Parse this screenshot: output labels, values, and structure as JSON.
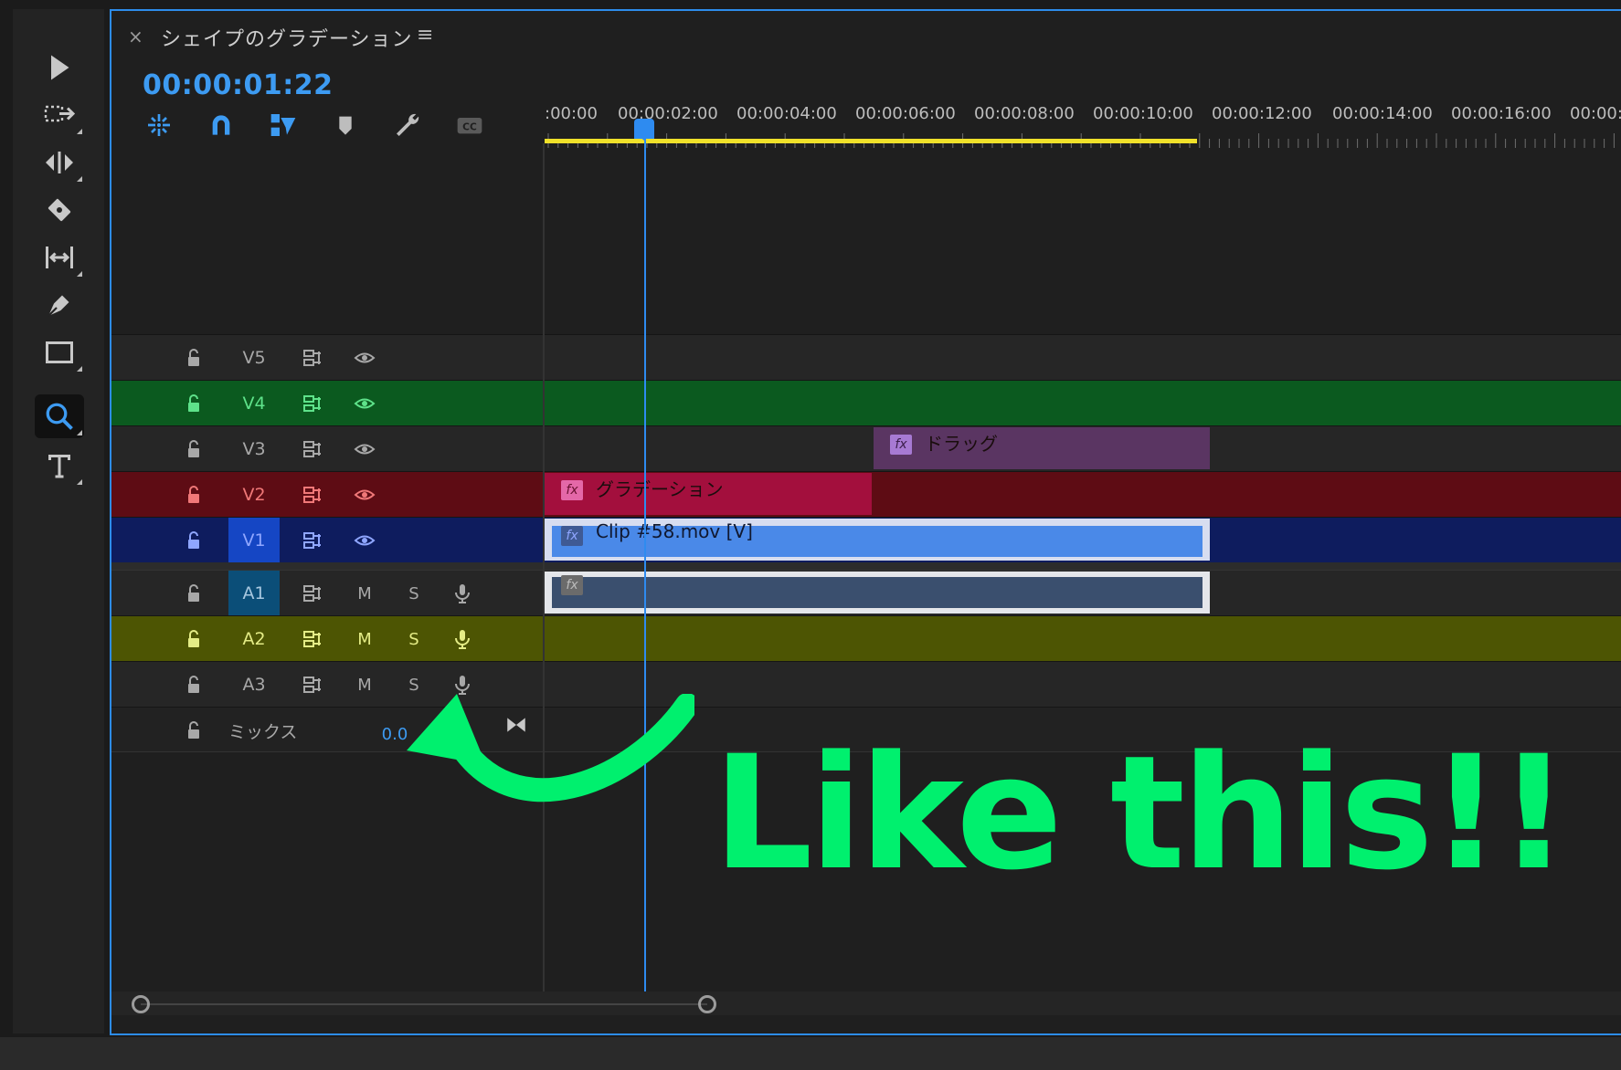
{
  "tools": [
    {
      "name": "selection-tool",
      "icon": "arrow-pointer-icon"
    },
    {
      "name": "track-select-tool",
      "icon": "track-select-icon"
    },
    {
      "name": "ripple-edit-tool",
      "icon": "ripple-edit-icon"
    },
    {
      "name": "razor-tool",
      "icon": "razor-icon"
    },
    {
      "name": "slip-tool",
      "icon": "slip-icon"
    },
    {
      "name": "pen-tool",
      "icon": "pen-icon"
    },
    {
      "name": "rectangle-tool",
      "icon": "rectangle-icon"
    },
    {
      "name": "zoom-tool",
      "icon": "magnifier-icon",
      "active": true
    },
    {
      "name": "type-tool",
      "icon": "type-icon"
    }
  ],
  "panel": {
    "close_glyph": "×",
    "title": "シェイプのグラデーション",
    "menu_glyph": "≡",
    "timecode": "00:00:01:22"
  },
  "timeline_tools": [
    "nest-icon",
    "snap-magnet-icon",
    "linked-selection-icon",
    "add-marker-icon",
    "wrench-settings-icon",
    "captions-cc-icon"
  ],
  "ruler_labels": [
    ":00:00",
    "00:00:02:00",
    "00:00:04:00",
    "00:00:06:00",
    "00:00:08:00",
    "00:00:10:00",
    "00:00:12:00",
    "00:00:14:00",
    "00:00:16:00",
    "00:00:"
  ],
  "tracks": {
    "video": [
      {
        "id": "V5",
        "label": "V5"
      },
      {
        "id": "V4",
        "label": "V4"
      },
      {
        "id": "V3",
        "label": "V3"
      },
      {
        "id": "V2",
        "label": "V2"
      },
      {
        "id": "V1",
        "label": "V1"
      }
    ],
    "audio": [
      {
        "id": "A1",
        "label": "A1",
        "mute": "M",
        "solo": "S"
      },
      {
        "id": "A2",
        "label": "A2",
        "mute": "M",
        "solo": "S"
      },
      {
        "id": "A3",
        "label": "A3",
        "mute": "M",
        "solo": "S"
      }
    ],
    "mix": {
      "label": "ミックス",
      "value": "0.0"
    }
  },
  "clips": {
    "v3": {
      "fx": "fx",
      "name": "ドラッグ"
    },
    "v2": {
      "fx": "fx",
      "name": "グラデーション"
    },
    "v1": {
      "fx": "fx",
      "name": "Clip #58.mov [V]"
    },
    "a1": {
      "fx": "fx",
      "name": ""
    }
  },
  "annotation": {
    "text": "Like this!!",
    "color": "#00f06e"
  },
  "colors": {
    "accent": "#2e8bf0",
    "v4_track": "#0b5a1f",
    "v2_track": "#5e0c14",
    "v1_track": "#0e1c5e",
    "a2_track": "#4d5503",
    "workarea": "#f0e12a"
  }
}
